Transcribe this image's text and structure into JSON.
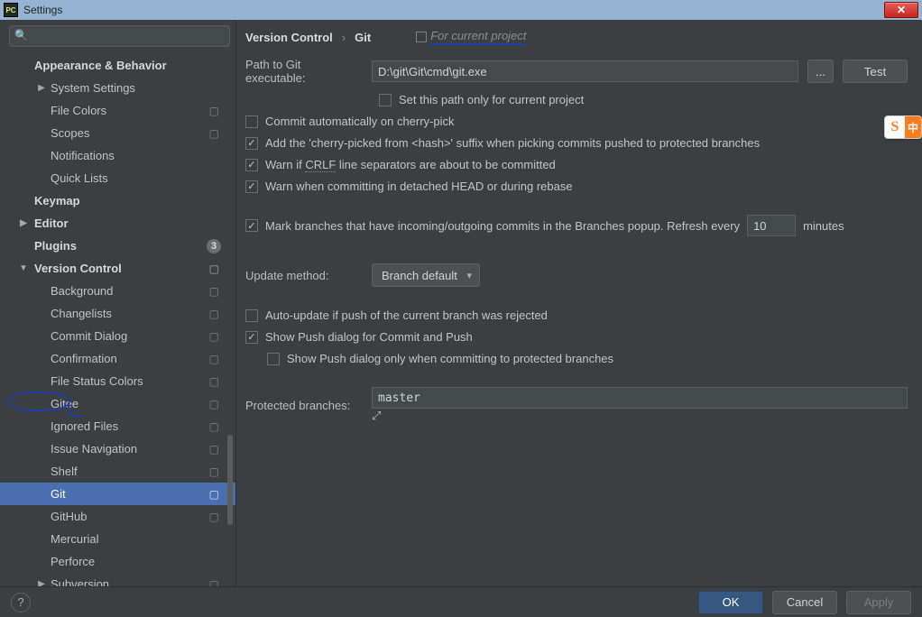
{
  "window": {
    "title": "Settings"
  },
  "search": {
    "placeholder": ""
  },
  "sidebar": {
    "appearance": "Appearance & Behavior",
    "system_settings": "System Settings",
    "file_colors": "File Colors",
    "scopes": "Scopes",
    "notifications": "Notifications",
    "quick_lists": "Quick Lists",
    "keymap": "Keymap",
    "editor": "Editor",
    "plugins": "Plugins",
    "plugins_badge": "3",
    "version_control": "Version Control",
    "background": "Background",
    "changelists": "Changelists",
    "commit_dialog": "Commit Dialog",
    "confirmation": "Confirmation",
    "file_status_colors": "File Status Colors",
    "gitee": "Gitee",
    "ignored_files": "Ignored Files",
    "issue_navigation": "Issue Navigation",
    "shelf": "Shelf",
    "git": "Git",
    "github": "GitHub",
    "mercurial": "Mercurial",
    "perforce": "Perforce",
    "subversion": "Subversion"
  },
  "breadcrumb": {
    "main": "Version Control",
    "sep": "›",
    "sub": "Git",
    "hint": "For current project"
  },
  "git": {
    "path_label": "Path to Git executable:",
    "path_value": "D:\\git\\Git\\cmd\\git.exe",
    "browse": "...",
    "test": "Test",
    "set_path_current": "Set this path only for current project",
    "commit_auto_cherry": "Commit automatically on cherry-pick",
    "add_suffix": "Add the 'cherry-picked from <hash>' suffix when picking commits pushed to protected branches",
    "warn_crlf_pre": "Warn if ",
    "warn_crlf_underline": "CRLF",
    "warn_crlf_post": " line separators are about to be committed",
    "warn_detached": "Warn when committing in detached HEAD or during rebase",
    "mark_branches": "Mark branches that have incoming/outgoing commits in the Branches popup.  Refresh every",
    "refresh_value": "10",
    "minutes": "minutes",
    "update_method_label": "Update method:",
    "update_method_value": "Branch default",
    "auto_update_push": "Auto-update if push of the current branch was rejected",
    "show_push_dialog": "Show Push dialog for Commit and Push",
    "show_push_protected": "Show Push dialog only when committing to protected branches",
    "protected_branches_label": "Protected branches:",
    "protected_branches_value": "master"
  },
  "footer": {
    "ok": "OK",
    "cancel": "Cancel",
    "apply": "Apply",
    "help": "?"
  },
  "ime": {
    "s": "S",
    "zh": "中"
  }
}
